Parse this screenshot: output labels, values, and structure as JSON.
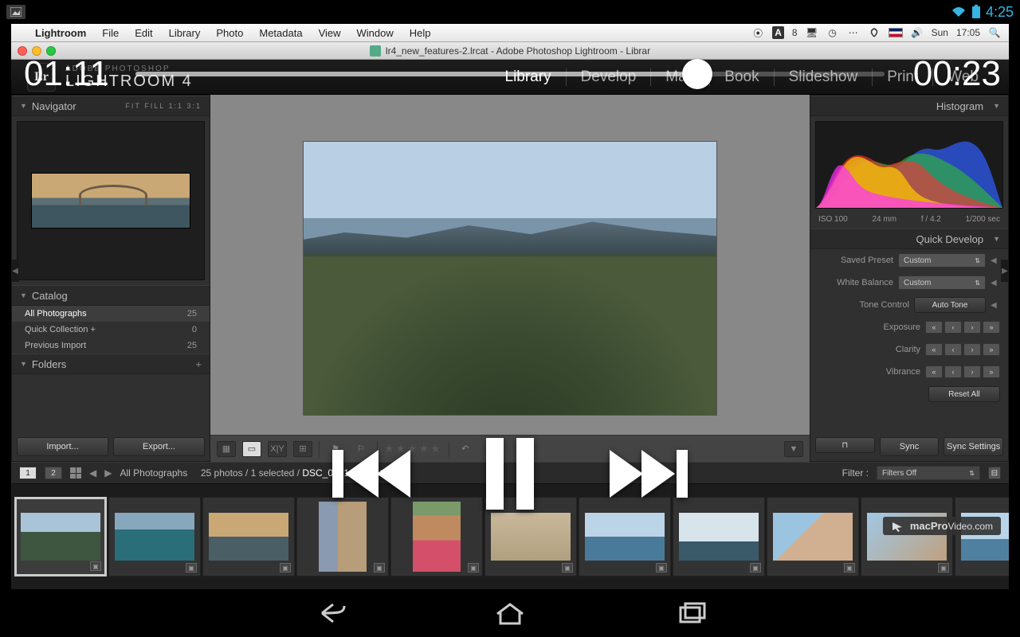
{
  "android": {
    "clock": "4:25"
  },
  "mac_menu": {
    "app": "Lightroom",
    "items": [
      "File",
      "Edit",
      "Library",
      "Photo",
      "Metadata",
      "View",
      "Window",
      "Help"
    ],
    "sys": {
      "adobe_badge": "A",
      "adobe_count": "8",
      "day": "Sun",
      "time": "17:05"
    }
  },
  "window_title": "lr4_new_features-2.lrcat - Adobe Photoshop Lightroom - Librar",
  "app_header": {
    "brand_top": "ADOBE PHOTOSHOP",
    "brand_main": "LIGHTROOM 4",
    "logo": "Lr",
    "modules": [
      "Library",
      "Develop",
      "Map",
      "Book",
      "Slideshow",
      "Print",
      "Web"
    ],
    "active_module": "Library"
  },
  "left": {
    "navigator": {
      "title": "Navigator",
      "opt_labels": [
        "FIT",
        "FILL",
        "1:1",
        "3:1"
      ]
    },
    "catalog": {
      "title": "Catalog",
      "rows": [
        {
          "label": "All Photographs",
          "count": "25",
          "sel": true
        },
        {
          "label": "Quick Collection  +",
          "count": "0",
          "sel": false
        },
        {
          "label": "Previous Import",
          "count": "25",
          "sel": false
        }
      ]
    },
    "folders": {
      "title": "Folders"
    },
    "import_btn": "Import...",
    "export_btn": "Export..."
  },
  "right": {
    "histogram": {
      "title": "Histogram",
      "meta": [
        "ISO 100",
        "24 mm",
        "f / 4.2",
        "1/200 sec"
      ]
    },
    "quick_develop": {
      "title": "Quick Develop",
      "saved_preset_label": "Saved Preset",
      "saved_preset_value": "Custom",
      "white_balance_label": "White Balance",
      "white_balance_value": "Custom",
      "tone_label": "Tone Control",
      "auto_tone": "Auto Tone",
      "exposure_label": "Exposure",
      "clarity_label": "Clarity",
      "vibrance_label": "Vibrance",
      "reset": "Reset All"
    },
    "sync": "Sync",
    "sync_settings": "Sync Settings"
  },
  "filmstrip": {
    "monitor1": "1",
    "monitor2": "2",
    "breadcrumb": "All Photographs",
    "status": "25 photos / 1 selected /",
    "filename": "DSC_0001-2-Edit.tif",
    "filter_label": "Filter :",
    "filter_value": "Filters Off"
  },
  "video": {
    "elapsed": "01:11",
    "remaining": "00:23"
  },
  "watermark": {
    "brand": "macPro",
    "suffix": "Video.com"
  }
}
